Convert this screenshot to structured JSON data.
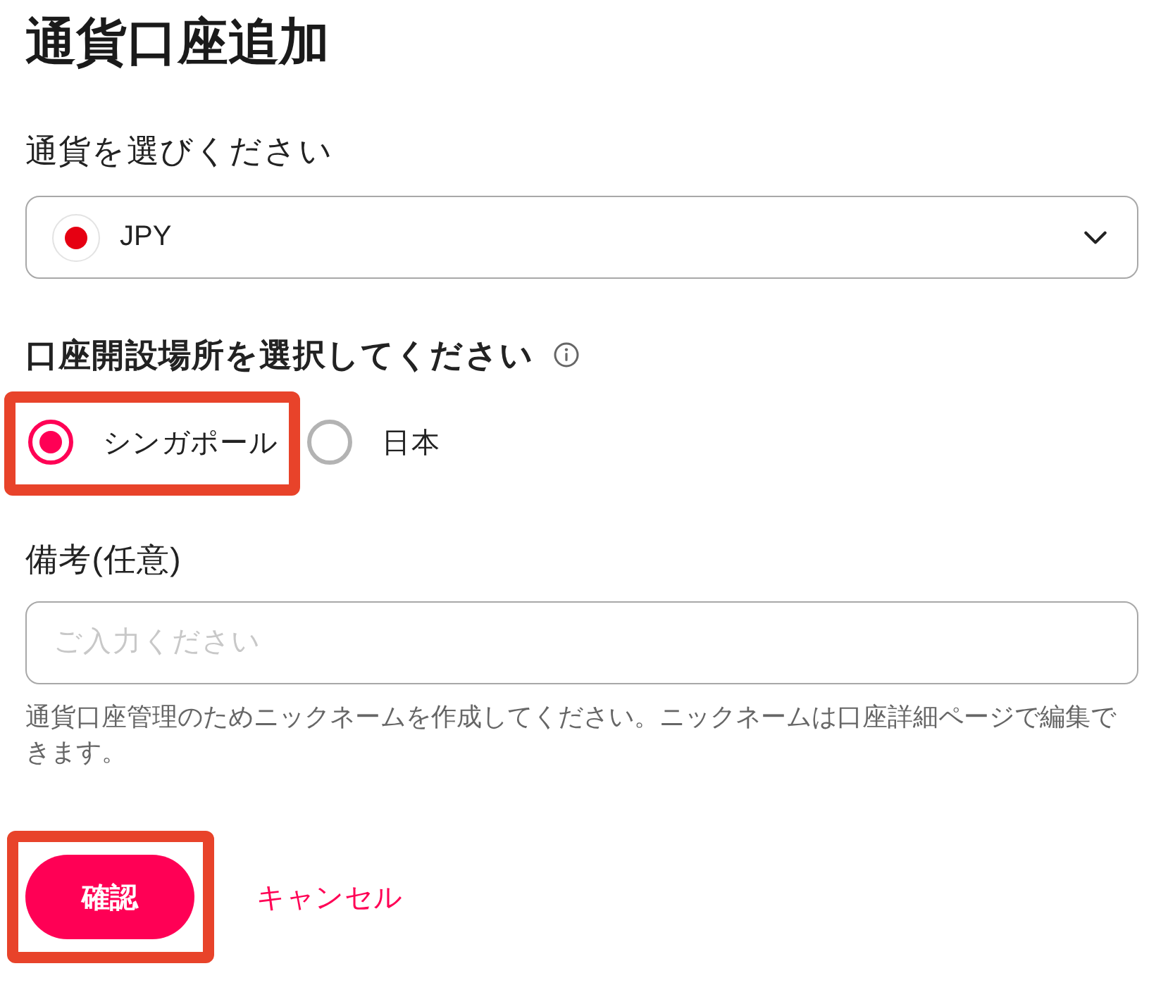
{
  "title": "通貨口座追加",
  "currency": {
    "label": "通貨を選びください",
    "value": "JPY"
  },
  "location": {
    "label": "口座開設場所を選択してください",
    "options": [
      {
        "label": "シンガポール",
        "selected": true,
        "highlighted": true
      },
      {
        "label": "日本",
        "selected": false,
        "highlighted": false
      }
    ]
  },
  "remarks": {
    "label": "備考(任意)",
    "placeholder": "ご入力ください",
    "help": "通貨口座管理のためニックネームを作成してください。ニックネームは口座詳細ページで編集できます。"
  },
  "actions": [
    {
      "kind": "primary",
      "label": "確認",
      "highlighted": true
    },
    {
      "kind": "link",
      "label": "キャンセル",
      "highlighted": false
    }
  ]
}
